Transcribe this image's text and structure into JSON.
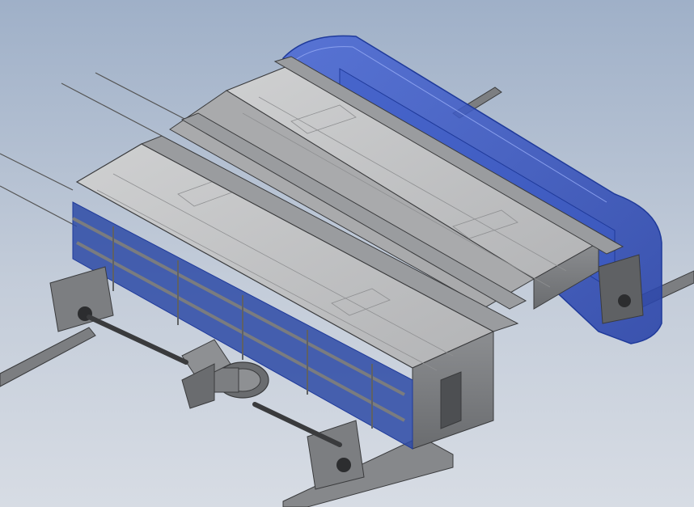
{
  "scene": {
    "kind": "cad-isometric-assembly",
    "colors": {
      "background_top": "#9fb0c8",
      "background_bottom": "#d7dce4",
      "steel": "#8e9093",
      "steel_light": "#b9bbbd",
      "steel_dark": "#5f6164",
      "panel_top": "#c2c3c4",
      "panel_line": "#8f9092",
      "blue_frame": "#2f4fa8",
      "blue_housing": "#3556c8",
      "edge": "#3a3b3d"
    },
    "parts": [
      "rail-front",
      "rail-back",
      "blue-enclosure",
      "upper-conveyor-bed",
      "lower-conveyor-bed",
      "side-frame",
      "drive-motor",
      "gearbox",
      "bearing-blocks",
      "cables"
    ]
  }
}
